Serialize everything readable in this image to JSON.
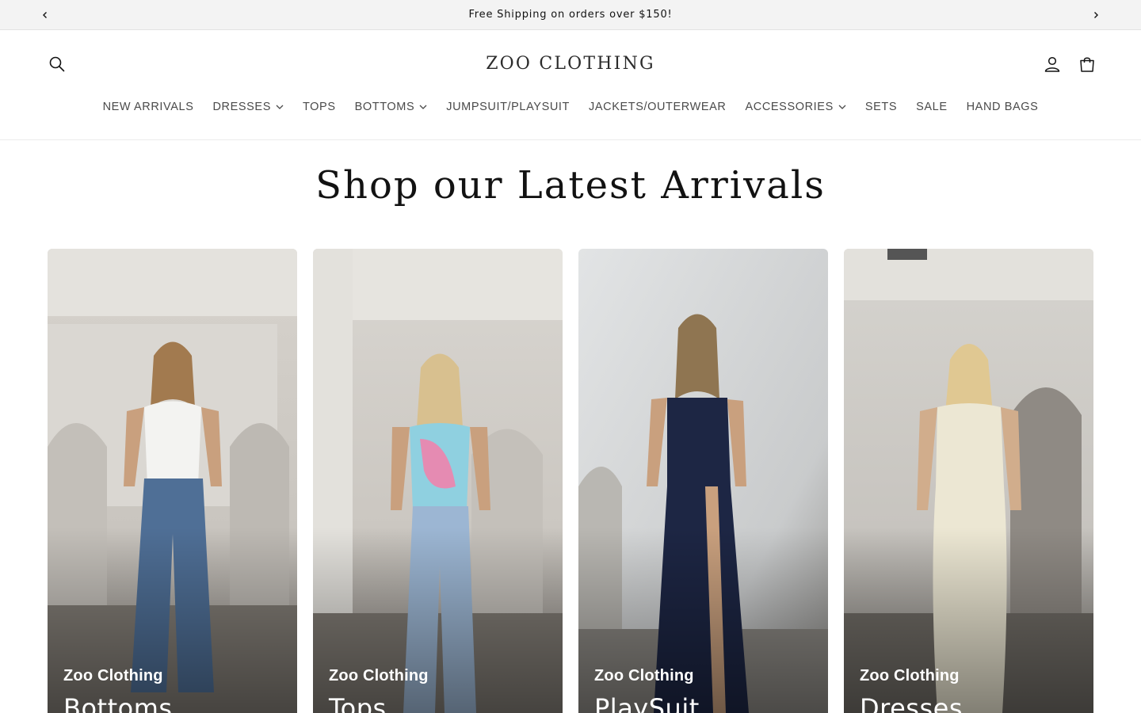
{
  "announcement": {
    "text": "Free Shipping on orders over $150!",
    "prev_icon": "chevron-left-icon",
    "next_icon": "chevron-right-icon"
  },
  "header": {
    "logo": "ZOO CLOTHING",
    "icons": {
      "search": "search-icon",
      "account": "user-icon",
      "cart": "bag-icon"
    }
  },
  "nav": {
    "items": [
      {
        "label": "NEW ARRIVALS",
        "dropdown": false
      },
      {
        "label": "DRESSES",
        "dropdown": true
      },
      {
        "label": "TOPS",
        "dropdown": false
      },
      {
        "label": "BOTTOMS",
        "dropdown": true
      },
      {
        "label": "JUMPSUIT/PLAYSUIT",
        "dropdown": false
      },
      {
        "label": "JACKETS/OUTERWEAR",
        "dropdown": false
      },
      {
        "label": "ACCESSORIES",
        "dropdown": true
      },
      {
        "label": "SETS",
        "dropdown": false
      },
      {
        "label": "SALE",
        "dropdown": false
      },
      {
        "label": "HAND BAGS",
        "dropdown": false
      }
    ]
  },
  "main": {
    "headline": "Shop our Latest Arrivals",
    "collections": [
      {
        "brand": "Zoo Clothing",
        "title": "Bottoms"
      },
      {
        "brand": "Zoo Clothing",
        "title": "Tops"
      },
      {
        "brand": "Zoo Clothing",
        "title": "PlaySuit"
      },
      {
        "brand": "Zoo Clothing",
        "title": "Dresses"
      }
    ]
  },
  "colors": {
    "announcement_bg": "#f3f3f3",
    "text": "#121212",
    "nav_text": "#4a4a4a",
    "card_text": "#ffffff"
  }
}
